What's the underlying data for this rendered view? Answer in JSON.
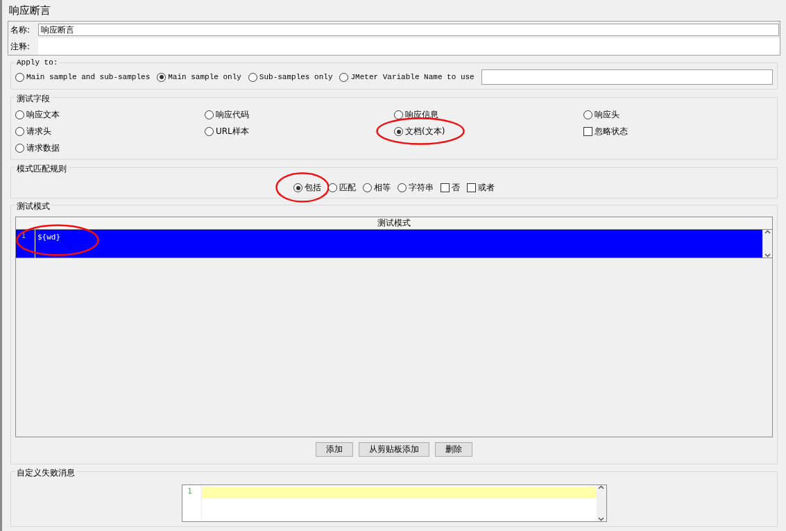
{
  "title": "响应断言",
  "name_field": {
    "label": "名称:",
    "value": "响应断言"
  },
  "comment_field": {
    "label": "注释:"
  },
  "apply_to": {
    "legend": "Apply to:",
    "options": [
      {
        "label": "Main sample and sub-samples",
        "selected": false
      },
      {
        "label": "Main sample only",
        "selected": true
      },
      {
        "label": "Sub-samples only",
        "selected": false
      },
      {
        "label": "JMeter Variable Name to use",
        "selected": false
      }
    ]
  },
  "test_field": {
    "legend": "测试字段",
    "items": [
      {
        "kind": "radio",
        "label": "响应文本",
        "selected": false,
        "annotated": false
      },
      {
        "kind": "radio",
        "label": "响应代码",
        "selected": false,
        "annotated": false
      },
      {
        "kind": "radio",
        "label": "响应信息",
        "selected": false,
        "annotated": false
      },
      {
        "kind": "radio",
        "label": "响应头",
        "selected": false,
        "annotated": false
      },
      {
        "kind": "radio",
        "label": "请求头",
        "selected": false,
        "annotated": false
      },
      {
        "kind": "radio",
        "label": "URL样本",
        "selected": false,
        "annotated": false
      },
      {
        "kind": "radio",
        "label": "文档(文本)",
        "selected": true,
        "annotated": true
      },
      {
        "kind": "checkbox",
        "label": "忽略状态",
        "checked": false,
        "annotated": false
      },
      {
        "kind": "radio",
        "label": "请求数据",
        "selected": false,
        "annotated": false
      }
    ]
  },
  "pattern_rules": {
    "legend": "模式匹配规则",
    "items": [
      {
        "kind": "radio",
        "label": "包括",
        "selected": true,
        "annotated": true
      },
      {
        "kind": "radio",
        "label": "匹配",
        "selected": false,
        "annotated": false
      },
      {
        "kind": "radio",
        "label": "相等",
        "selected": false,
        "annotated": false
      },
      {
        "kind": "radio",
        "label": "字符串",
        "selected": false,
        "annotated": false
      },
      {
        "kind": "checkbox",
        "label": "否",
        "checked": false,
        "annotated": false
      },
      {
        "kind": "checkbox",
        "label": "或者",
        "checked": false,
        "annotated": false
      }
    ]
  },
  "test_patterns": {
    "legend": "测试模式",
    "column": "测试模式",
    "rows": [
      {
        "line": "1",
        "text": "${wd}",
        "selected": true,
        "annotated": true
      }
    ]
  },
  "buttons": [
    "添加",
    "从剪贴板添加",
    "删除"
  ],
  "failure_message": {
    "legend": "自定义失败消息",
    "lines": [
      "1"
    ]
  }
}
